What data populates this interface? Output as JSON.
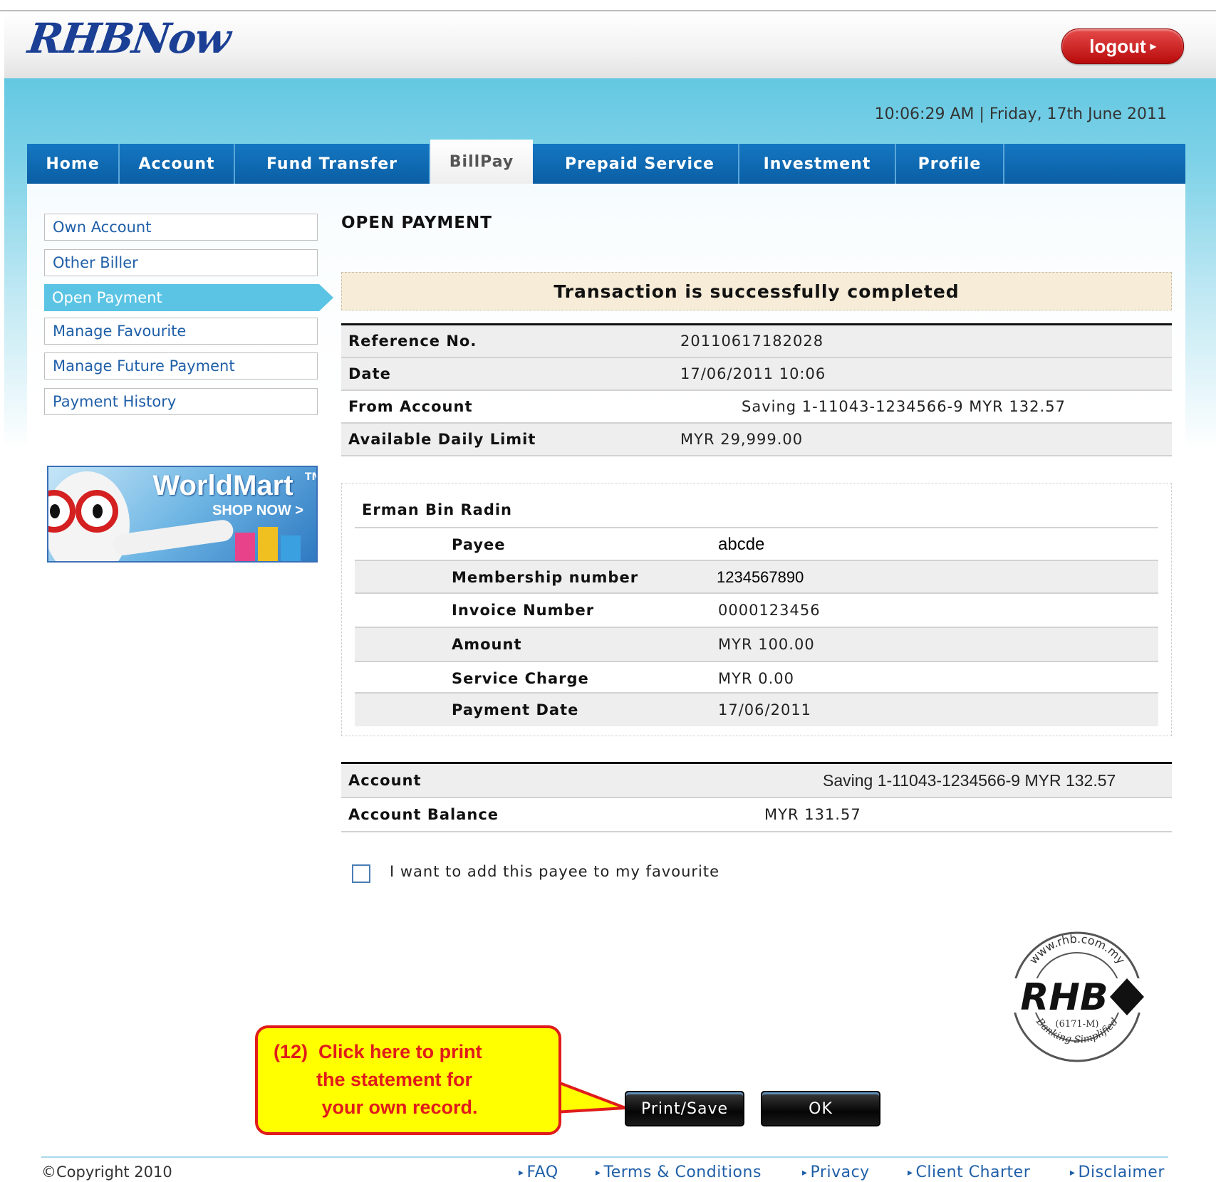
{
  "brand": {
    "logo": "RHBNow",
    "seal_url": "www.rhb.com.my",
    "seal_name": "RHB",
    "seal_reg": "(6171-M)",
    "seal_tag": "Banking Simplified"
  },
  "header": {
    "logout_label": "logout",
    "datetime": "10:06:29 AM | Friday, 17th June 2011"
  },
  "nav": {
    "tabs": [
      "Home",
      "Account",
      "Fund Transfer",
      "BillPay",
      "Prepaid Service",
      "Investment",
      "Profile"
    ],
    "active": "BillPay"
  },
  "sidebar": {
    "items": [
      "Own Account",
      "Other Biller",
      "Open Payment",
      "Manage Favourite",
      "Manage Future Payment",
      "Payment History"
    ],
    "active": "Open Payment"
  },
  "ad": {
    "title": "WorldMart",
    "tm": "TM",
    "cta": "SHOP NOW >"
  },
  "main": {
    "title": "OPEN PAYMENT",
    "status": "Transaction is successfully completed",
    "summary": [
      {
        "label": "Reference No.",
        "value": "20110617182028"
      },
      {
        "label": "Date",
        "value": "17/06/2011 10:06"
      },
      {
        "label": "From Account",
        "value": "Saving 1-11043-1234566-9 MYR 132.57"
      },
      {
        "label": "Available Daily Limit",
        "value": "MYR 29,999.00"
      }
    ],
    "payee_block": {
      "name": "Erman Bin Radin",
      "rows": [
        {
          "label": "Payee",
          "value": "abcde"
        },
        {
          "label": "Membership number",
          "value": "1234567890"
        },
        {
          "label": "Invoice Number",
          "value": "0000123456"
        },
        {
          "label": "Amount",
          "value": "MYR 100.00"
        },
        {
          "label": "Service Charge",
          "value": "MYR 0.00"
        },
        {
          "label": "Payment Date",
          "value": "17/06/2011"
        }
      ]
    },
    "balance": [
      {
        "label": "Account",
        "value": "Saving 1-11043-1234566-9 MYR 132.57"
      },
      {
        "label": "Account Balance",
        "value": "MYR 131.57"
      }
    ],
    "favourite_label": "I want to add this payee to my favourite",
    "favourite_checked": false
  },
  "callout": {
    "lines": [
      "(12)  Click here to print",
      "        the statement for",
      "         your own record."
    ]
  },
  "buttons": {
    "print": "Print/Save",
    "ok": "OK"
  },
  "footer": {
    "copyright": "©Copyright 2010",
    "links": [
      "FAQ",
      "Terms & Conditions",
      "Privacy",
      "Client Charter",
      "Disclaimer"
    ]
  },
  "colors": {
    "brand_blue": "#1a3f94",
    "nav_blue": "#0a6bb5",
    "sky": "#6ccbe5",
    "logout_red": "#c81414",
    "callout_yellow": "#ffff00",
    "callout_red": "#e01b1b"
  }
}
